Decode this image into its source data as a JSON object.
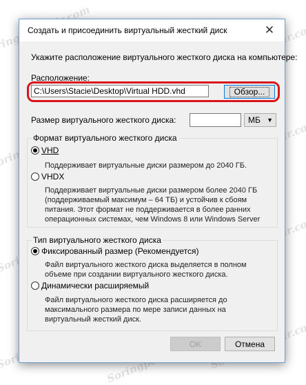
{
  "dialog": {
    "title": "Создать и присоединить виртуальный жесткий диск",
    "instruction": "Укажите расположение виртуального жесткого диска на компьютере:",
    "location_label": "Расположение:",
    "location_value": "C:\\Users\\Stacie\\Desktop\\Virtual HDD.vhd",
    "browse_label": "Обзор...",
    "size_label": "Размер виртуального жесткого диска:",
    "size_value": "",
    "size_unit": "МБ",
    "format_group": {
      "legend": "Формат виртуального жесткого диска",
      "vhd_label": "VHD",
      "vhd_desc": "Поддерживает виртуальные диски размером до 2040 ГБ.",
      "vhdx_label": "VHDX",
      "vhdx_desc": "Поддерживает виртуальные диски размером более 2040 ГБ (поддерживаемый максимум – 64 ТБ) и устойчив к сбоям питания. Этот формат не поддерживается в более ранних операционных системах, чем Windows 8 или Windows Server"
    },
    "type_group": {
      "legend": "Тип виртуального жесткого диска",
      "fixed_label": "Фиксированный размер (Рекомендуется)",
      "fixed_desc": "Файл виртуального жесткого диска выделяется в полном объеме при создании виртуального жесткого диска.",
      "dynamic_label": "Динамически расширяемый",
      "dynamic_desc": "Файл виртуального жесткого диска расширяется до максимального размера по мере записи данных на виртуальный жесткий диск."
    },
    "ok_label": "OK",
    "cancel_label": "Отмена"
  },
  "watermark": "Soringpcrepair.com",
  "icons": {
    "close": "close-icon"
  },
  "colors": {
    "highlight": "#d9141b",
    "accent": "#0078d7"
  }
}
